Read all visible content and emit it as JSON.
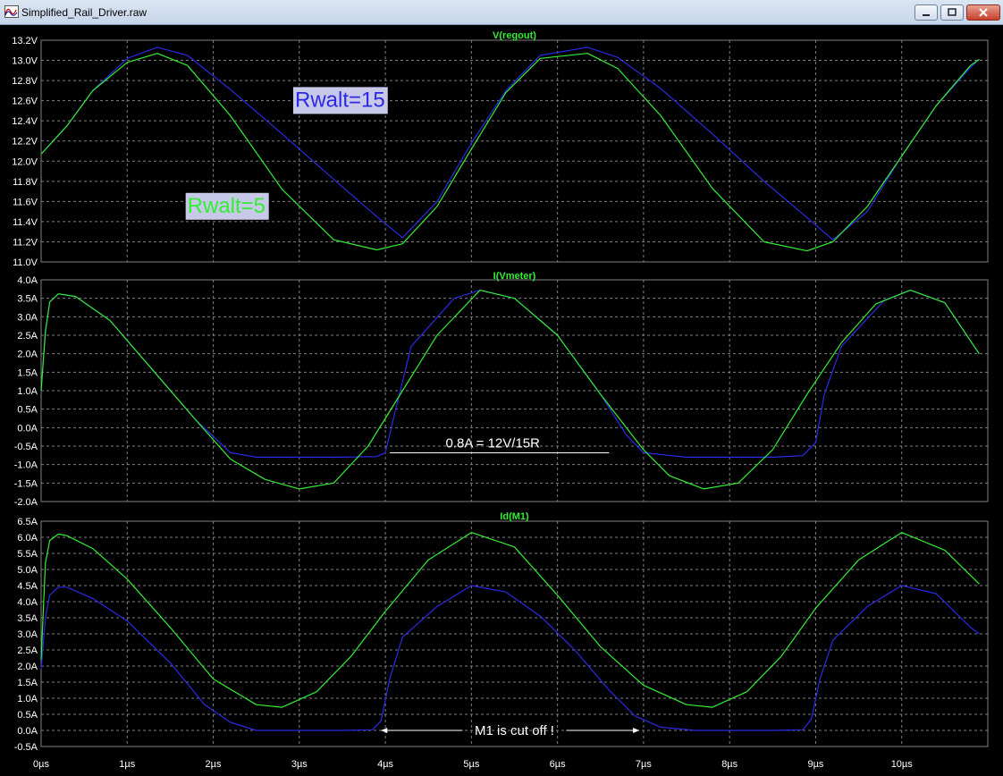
{
  "window": {
    "title": "Simplified_Rail_Driver.raw"
  },
  "colors": {
    "background": "#000000",
    "grid": "#808080",
    "rwalt15": "#2a2ae6",
    "rwalt5": "#33ee33",
    "pane_title": "#33ee33",
    "axis_text": "#ffffff"
  },
  "chart_data": [
    {
      "type": "line",
      "title": "V(regout)",
      "xlabel": "",
      "ylabel": "",
      "xlim": [
        0,
        11
      ],
      "ylim": [
        11.0,
        13.2
      ],
      "x_ticks": [
        "0µs",
        "1µs",
        "2µs",
        "3µs",
        "4µs",
        "5µs",
        "6µs",
        "7µs",
        "8µs",
        "9µs",
        "10µs"
      ],
      "y_ticks": [
        "11.0V",
        "11.2V",
        "11.4V",
        "11.6V",
        "11.8V",
        "12.0V",
        "12.2V",
        "12.4V",
        "12.6V",
        "12.8V",
        "13.0V",
        "13.2V"
      ],
      "grid": true,
      "series": [
        {
          "name": "Rwalt=15",
          "color": "#2a2ae6",
          "x": [
            0,
            0.3,
            0.6,
            1.0,
            1.35,
            1.7,
            2.2,
            2.8,
            3.4,
            3.9,
            4.2,
            4.6,
            5.0,
            5.4,
            5.8,
            6.35,
            6.7,
            7.2,
            7.8,
            8.4,
            8.9,
            9.2,
            9.6,
            10.0,
            10.4,
            10.8,
            10.9
          ],
          "y": [
            12.07,
            12.35,
            12.7,
            13.02,
            13.13,
            13.05,
            12.71,
            12.27,
            11.82,
            11.45,
            11.24,
            11.6,
            12.18,
            12.7,
            13.05,
            13.13,
            13.03,
            12.72,
            12.27,
            11.8,
            11.44,
            11.22,
            11.5,
            12.05,
            12.55,
            12.93,
            13.01
          ]
        },
        {
          "name": "Rwalt=5",
          "color": "#33ee33",
          "x": [
            0,
            0.3,
            0.6,
            1.0,
            1.35,
            1.7,
            2.2,
            2.8,
            3.4,
            3.9,
            4.2,
            4.6,
            5.0,
            5.4,
            5.8,
            6.35,
            6.7,
            7.2,
            7.8,
            8.4,
            8.9,
            9.2,
            9.6,
            10.0,
            10.4,
            10.8,
            10.9
          ],
          "y": [
            12.07,
            12.35,
            12.7,
            12.98,
            13.07,
            12.95,
            12.45,
            11.72,
            11.22,
            11.12,
            11.18,
            11.55,
            12.12,
            12.68,
            13.02,
            13.07,
            12.92,
            12.45,
            11.73,
            11.2,
            11.11,
            11.2,
            11.55,
            12.05,
            12.55,
            12.95,
            13.01
          ]
        }
      ],
      "annotations": [
        {
          "text": "Rwalt=15",
          "color": "#2a2ae6",
          "x": 2.95,
          "y": 12.54
        },
        {
          "text": "Rwalt=5",
          "color": "#33ee33",
          "x": 1.7,
          "y": 11.49
        }
      ]
    },
    {
      "type": "line",
      "title": "I(Vmeter)",
      "xlabel": "",
      "ylabel": "",
      "xlim": [
        0,
        11
      ],
      "ylim": [
        -2.0,
        4.0
      ],
      "x_ticks": [
        "0µs",
        "1µs",
        "2µs",
        "3µs",
        "4µs",
        "5µs",
        "6µs",
        "7µs",
        "8µs",
        "9µs",
        "10µs"
      ],
      "y_ticks": [
        "-2.0A",
        "-1.5A",
        "-1.0A",
        "-0.5A",
        "0.0A",
        "0.5A",
        "1.0A",
        "1.5A",
        "2.0A",
        "2.5A",
        "3.0A",
        "3.5A",
        "4.0A"
      ],
      "grid": true,
      "series": [
        {
          "name": "Rwalt=15",
          "color": "#2a2ae6",
          "x": [
            0,
            0.05,
            0.1,
            0.2,
            0.4,
            0.8,
            1.3,
            1.8,
            2.2,
            2.5,
            3.0,
            3.5,
            3.9,
            4.0,
            4.1,
            4.3,
            4.8,
            5.1,
            5.5,
            6.0,
            6.5,
            6.8,
            7.0,
            7.5,
            8.0,
            8.5,
            8.85,
            9.0,
            9.1,
            9.3,
            9.8,
            10.1,
            10.5,
            10.9
          ],
          "y": [
            1.0,
            2.6,
            3.4,
            3.62,
            3.55,
            2.9,
            1.55,
            0.2,
            -0.68,
            -0.8,
            -0.8,
            -0.8,
            -0.78,
            -0.68,
            0.3,
            2.2,
            3.5,
            3.72,
            3.5,
            2.5,
            0.9,
            -0.2,
            -0.68,
            -0.8,
            -0.8,
            -0.8,
            -0.76,
            -0.4,
            0.9,
            2.2,
            3.45,
            3.72,
            3.38,
            2.0
          ]
        },
        {
          "name": "Rwalt=5",
          "color": "#33ee33",
          "x": [
            0,
            0.05,
            0.1,
            0.2,
            0.4,
            0.8,
            1.3,
            1.8,
            2.2,
            2.6,
            3.0,
            3.4,
            3.8,
            4.2,
            4.6,
            5.1,
            5.5,
            6.0,
            6.5,
            7.0,
            7.3,
            7.7,
            8.1,
            8.5,
            8.9,
            9.3,
            9.7,
            10.1,
            10.5,
            10.9
          ],
          "y": [
            1.0,
            2.6,
            3.4,
            3.62,
            3.55,
            2.9,
            1.55,
            0.2,
            -0.85,
            -1.4,
            -1.66,
            -1.5,
            -0.5,
            1.0,
            2.5,
            3.72,
            3.5,
            2.5,
            0.9,
            -0.6,
            -1.3,
            -1.66,
            -1.5,
            -0.6,
            0.9,
            2.3,
            3.35,
            3.72,
            3.38,
            2.0
          ]
        }
      ],
      "annotations": [
        {
          "text": "0.8A = 12V/15R",
          "color": "#ffffff",
          "x": 4.7,
          "y": -0.68
        }
      ]
    },
    {
      "type": "line",
      "title": "Id(M1)",
      "xlabel": "",
      "ylabel": "",
      "xlim": [
        0,
        11
      ],
      "ylim": [
        -0.5,
        6.5
      ],
      "x_ticks": [
        "0µs",
        "1µs",
        "2µs",
        "3µs",
        "4µs",
        "5µs",
        "6µs",
        "7µs",
        "8µs",
        "9µs",
        "10µs"
      ],
      "y_ticks": [
        "-0.5A",
        "0.0A",
        "0.5A",
        "1.0A",
        "1.5A",
        "2.0A",
        "2.5A",
        "3.0A",
        "3.5A",
        "4.0A",
        "4.5A",
        "5.0A",
        "5.5A",
        "6.0A",
        "6.5A"
      ],
      "grid": true,
      "series": [
        {
          "name": "Rwalt=15",
          "color": "#2a2ae6",
          "x": [
            0,
            0.05,
            0.1,
            0.2,
            0.3,
            0.6,
            1.0,
            1.5,
            1.9,
            2.2,
            2.5,
            3.0,
            3.5,
            3.85,
            3.95,
            4.05,
            4.2,
            4.6,
            5.0,
            5.4,
            5.8,
            6.2,
            6.6,
            6.9,
            7.2,
            7.6,
            8.0,
            8.5,
            8.85,
            8.95,
            9.05,
            9.2,
            9.6,
            10.0,
            10.4,
            10.8,
            10.9
          ],
          "y": [
            1.9,
            3.5,
            4.2,
            4.45,
            4.45,
            4.1,
            3.4,
            2.1,
            0.8,
            0.25,
            0.0,
            0.0,
            0.0,
            0.02,
            0.3,
            1.6,
            2.9,
            3.85,
            4.5,
            4.3,
            3.55,
            2.5,
            1.25,
            0.45,
            0.1,
            0.0,
            0.0,
            0.0,
            0.02,
            0.35,
            1.6,
            2.8,
            3.85,
            4.5,
            4.25,
            3.2,
            3.0
          ]
        },
        {
          "name": "Rwalt=5",
          "color": "#33ee33",
          "x": [
            0,
            0.05,
            0.1,
            0.2,
            0.3,
            0.6,
            1.0,
            1.5,
            2.0,
            2.5,
            2.8,
            3.2,
            3.6,
            4.0,
            4.5,
            5.0,
            5.5,
            6.0,
            6.5,
            7.0,
            7.5,
            7.8,
            8.2,
            8.6,
            9.0,
            9.5,
            10.0,
            10.5,
            10.9
          ],
          "y": [
            2.2,
            5.2,
            5.9,
            6.1,
            6.05,
            5.65,
            4.7,
            3.2,
            1.6,
            0.8,
            0.72,
            1.2,
            2.3,
            3.7,
            5.3,
            6.15,
            5.7,
            4.2,
            2.6,
            1.4,
            0.8,
            0.72,
            1.2,
            2.3,
            3.8,
            5.3,
            6.15,
            5.6,
            4.55
          ]
        }
      ],
      "annotations": [
        {
          "text": "M1 is cut off !",
          "color": "#ffffff",
          "x": 5.5,
          "y": 0.0
        }
      ]
    }
  ]
}
